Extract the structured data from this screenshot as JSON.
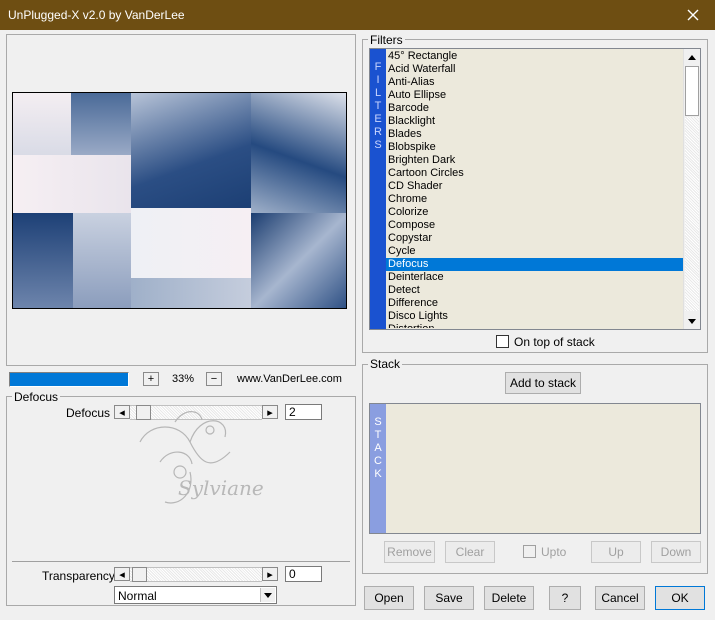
{
  "window": {
    "title": "UnPlugged-X v2.0 by VanDerLee"
  },
  "zoom": {
    "plus": "+",
    "value": "33%",
    "minus": "−",
    "website": "www.VanDerLee.com"
  },
  "defocus_group": {
    "legend": "Defocus",
    "param_label": "Defocus",
    "param_value": "2",
    "transparency_label": "Transparency",
    "transparency_value": "0",
    "blend_mode": "Normal",
    "watermark": "Sylviane"
  },
  "filters": {
    "legend": "Filters",
    "strip_letters": [
      "F",
      "I",
      "L",
      "T",
      "E",
      "R",
      "S"
    ],
    "items": [
      "45° Rectangle",
      "Acid Waterfall",
      "Anti-Alias",
      "Auto Ellipse",
      "Barcode",
      "Blacklight",
      "Blades",
      "Blobspike",
      "Brighten Dark",
      "Cartoon Circles",
      "CD Shader",
      "Chrome",
      "Colorize",
      "Compose",
      "Copystar",
      "Cycle",
      "Defocus",
      "Deinterlace",
      "Detect",
      "Difference",
      "Disco Lights",
      "Distortion"
    ],
    "selected": "Defocus",
    "on_top_label": "On top of stack"
  },
  "stack": {
    "legend": "Stack",
    "add_label": "Add to stack",
    "strip_letters": [
      "S",
      "T",
      "A",
      "C",
      "K"
    ],
    "remove_label": "Remove",
    "clear_label": "Clear",
    "upto_label": "Upto",
    "up_label": "Up",
    "down_label": "Down"
  },
  "buttons": {
    "open": "Open",
    "save": "Save",
    "delete": "Delete",
    "help": "?",
    "cancel": "Cancel",
    "ok": "OK"
  },
  "colors": {
    "titlebar": "#6e4e12",
    "selection": "#0078d7",
    "filters_strip": "#1a52d0",
    "stack_strip": "#8a9ee0",
    "progress": "#0078d7"
  }
}
